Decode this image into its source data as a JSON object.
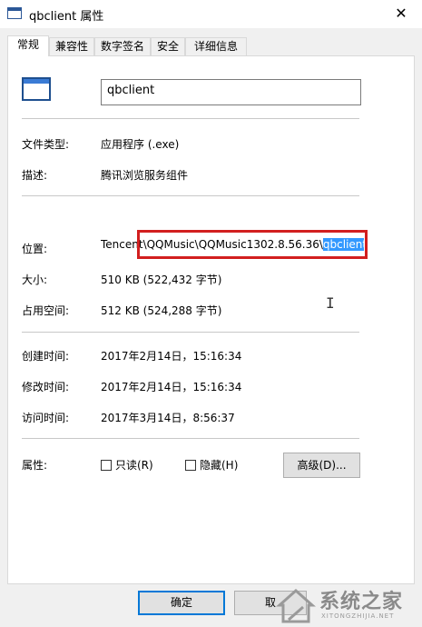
{
  "window": {
    "title": "qbclient 属性",
    "close_glyph": "✕"
  },
  "tabs": [
    {
      "label": "常规",
      "active": true
    },
    {
      "label": "兼容性",
      "active": false
    },
    {
      "label": "数字签名",
      "active": false
    },
    {
      "label": "安全",
      "active": false
    },
    {
      "label": "详细信息",
      "active": false
    }
  ],
  "general": {
    "file_name": "qbclient",
    "file_icon": "application-window-icon",
    "type_label": "文件类型:",
    "type_value": "应用程序 (.exe)",
    "desc_label": "描述:",
    "desc_value": "腾讯浏览服务组件",
    "location_label": "位置:",
    "location_value_prefix": "Tencent\\QQMusic\\QQMusic1302.8.56.36\\",
    "location_value_selected": "qbclient",
    "size_label": "大小:",
    "size_value": "510 KB (522,432 字节)",
    "disk_label": "占用空间:",
    "disk_value": "512 KB (524,288 字节)",
    "created_label": "创建时间:",
    "created_value": "2017年2月14日，15:16:34",
    "modified_label": "修改时间:",
    "modified_value": "2017年2月14日，15:16:34",
    "accessed_label": "访问时间:",
    "accessed_value": "2017年3月14日，8:56:37",
    "attr_label": "属性:",
    "readonly_label": "只读(R)",
    "readonly_checked": false,
    "hidden_label": "隐藏(H)",
    "hidden_checked": false,
    "advanced_label": "高级(D)..."
  },
  "footer": {
    "ok_label": "确定",
    "cancel_label": "取"
  },
  "watermark": {
    "text": "系统之家",
    "sub": "XITONGZHIJIA.NET"
  },
  "colors": {
    "highlight_frame": "#d21f1f",
    "selection": "#3399ff",
    "focus_border": "#0078d7"
  }
}
